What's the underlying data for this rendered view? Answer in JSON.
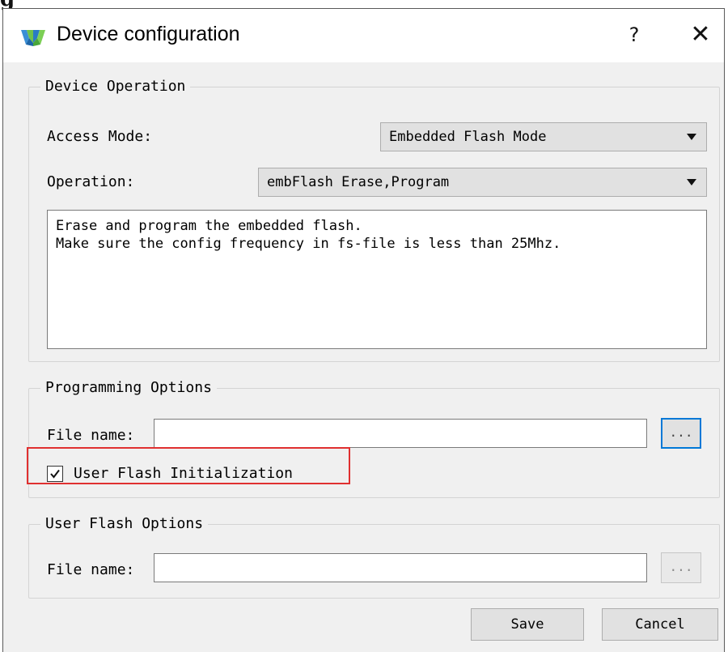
{
  "corner_text": "g",
  "window": {
    "title": "Device configuration",
    "help_label": "?",
    "close_label": "✕",
    "logo_icon": "gowin-logo-icon"
  },
  "device_operation": {
    "legend": "Device Operation",
    "access_mode_label": "Access Mode:",
    "access_mode_value": "Embedded Flash Mode",
    "operation_label": "Operation:",
    "operation_value": "embFlash Erase,Program",
    "description": "Erase and program the embedded flash.\nMake sure the config frequency in fs-file is less than 25Mhz."
  },
  "programming_options": {
    "legend": "Programming Options",
    "file_name_label": "File name:",
    "file_name_value": "",
    "browse_label": "...",
    "user_flash_init_label": "User Flash Initialization",
    "user_flash_init_checked": true
  },
  "user_flash_options": {
    "legend": "User Flash Options",
    "file_name_label": "File name:",
    "file_name_value": "",
    "browse_label": "..."
  },
  "footer": {
    "save_label": "Save",
    "cancel_label": "Cancel"
  },
  "colors": {
    "highlight": "#e03030",
    "focus": "#0078d7",
    "dialog_bg": "#f0f0f0"
  }
}
